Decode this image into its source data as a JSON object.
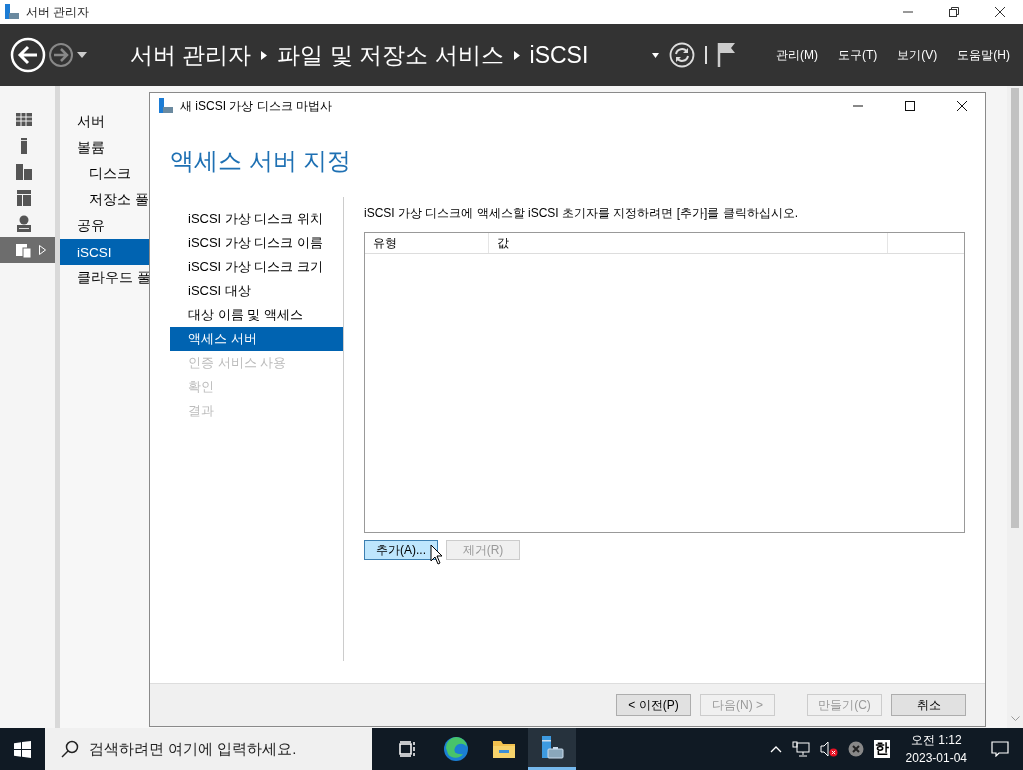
{
  "window": {
    "title": "서버 관리자"
  },
  "header": {
    "breadcrumb": [
      "서버 관리자",
      "파일 및 저장소 서비스",
      "iSCSI"
    ],
    "menus": [
      "관리(M)",
      "도구(T)",
      "보기(V)",
      "도움말(H)"
    ]
  },
  "icon_strip": [
    {
      "kind": "dashboard",
      "selected": false
    },
    {
      "kind": "local-server",
      "selected": false
    },
    {
      "kind": "all-servers",
      "selected": false
    },
    {
      "kind": "roles",
      "selected": false
    },
    {
      "kind": "web-server",
      "selected": false
    },
    {
      "kind": "file-services",
      "selected": true
    }
  ],
  "nav": [
    {
      "label": "서버",
      "selected": false
    },
    {
      "label": "볼륨",
      "selected": false,
      "children": [
        {
          "label": "디스크",
          "selected": false
        },
        {
          "label": "저장소 풀",
          "selected": false
        }
      ]
    },
    {
      "label": "공유",
      "selected": false
    },
    {
      "label": "iSCSI",
      "selected": true
    },
    {
      "label": "클라우드 풀",
      "selected": false
    }
  ],
  "dialog": {
    "title": "새 iSCSI 가상 디스크 마법사",
    "heading": "액세스 서버 지정",
    "steps": [
      {
        "label": "iSCSI 가상 디스크 위치",
        "selected": false,
        "disabled": false
      },
      {
        "label": "iSCSI 가상 디스크 이름",
        "selected": false,
        "disabled": false
      },
      {
        "label": "iSCSI 가상 디스크 크기",
        "selected": false,
        "disabled": false
      },
      {
        "label": "iSCSI 대상",
        "selected": false,
        "disabled": false
      },
      {
        "label": "대상 이름 및 액세스",
        "selected": false,
        "disabled": false
      },
      {
        "label": "액세스 서버",
        "selected": true,
        "disabled": false
      },
      {
        "label": "인증 서비스 사용",
        "selected": false,
        "disabled": true
      },
      {
        "label": "확인",
        "selected": false,
        "disabled": true
      },
      {
        "label": "결과",
        "selected": false,
        "disabled": true
      }
    ],
    "instruction": "iSCSI 가상 디스크에 액세스할 iSCSI 초기자를 지정하려면 [추가]를 클릭하십시오.",
    "table": {
      "columns": [
        "유형",
        "값"
      ]
    },
    "list_buttons": [
      {
        "label": "추가(A)...",
        "disabled": false,
        "hovered": true
      },
      {
        "label": "제거(R)",
        "disabled": true,
        "hovered": false
      }
    ],
    "footer_buttons": [
      {
        "label": "< 이전(P)",
        "disabled": false
      },
      {
        "label": "다음(N) >",
        "disabled": true
      },
      {
        "label": "만들기(C)",
        "disabled": true
      },
      {
        "label": "취소",
        "disabled": false
      }
    ]
  },
  "taskbar": {
    "search": {
      "placeholder": "검색하려면 여기에 입력하세요."
    },
    "apps": [
      {
        "kind": "task-view",
        "active": false
      },
      {
        "kind": "edge",
        "active": false
      },
      {
        "kind": "explorer",
        "active": false
      },
      {
        "kind": "server-manager",
        "active": true
      }
    ],
    "ime": "한",
    "time": "오전 1:12",
    "date": "2023-01-04"
  }
}
